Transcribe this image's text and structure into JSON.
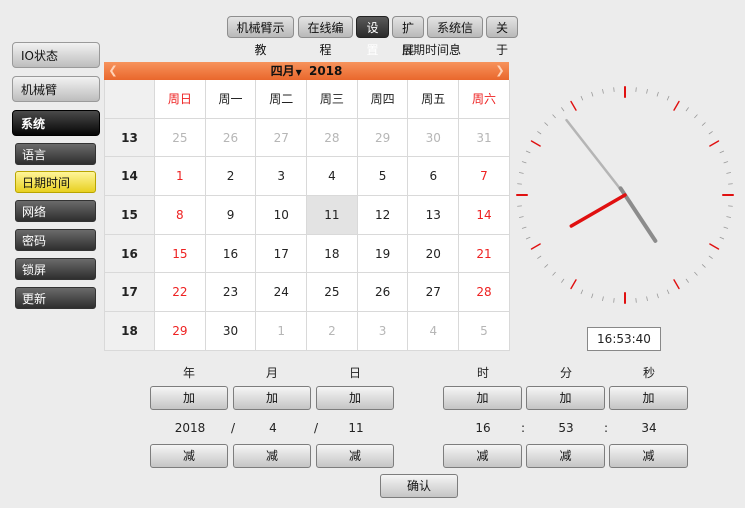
{
  "nav": {
    "tabs": [
      {
        "label": "机械臂示教",
        "active": false
      },
      {
        "label": "在线编程",
        "active": false
      },
      {
        "label": "设置",
        "active": true
      },
      {
        "label": "扩展",
        "active": false
      },
      {
        "label": "系统信息",
        "active": false
      },
      {
        "label": "关于",
        "active": false
      }
    ]
  },
  "section_title": "日期时间",
  "sidebar": {
    "main": [
      {
        "label": "IO状态"
      },
      {
        "label": "机械臂"
      },
      {
        "label": "系统",
        "active": true
      }
    ],
    "sub": [
      {
        "label": "语言"
      },
      {
        "label": "日期时间",
        "active": true
      },
      {
        "label": "网络"
      },
      {
        "label": "密码"
      },
      {
        "label": "锁屏"
      },
      {
        "label": "更新"
      }
    ]
  },
  "calendar": {
    "month": "四月",
    "year": "2018",
    "weekdays": [
      "周日",
      "周一",
      "周二",
      "周三",
      "周四",
      "周五",
      "周六"
    ],
    "weeks": [
      {
        "num": "13",
        "days": [
          "25",
          "26",
          "27",
          "28",
          "29",
          "30",
          "31"
        ]
      },
      {
        "num": "14",
        "days": [
          "1",
          "2",
          "3",
          "4",
          "5",
          "6",
          "7"
        ]
      },
      {
        "num": "15",
        "days": [
          "8",
          "9",
          "10",
          "11",
          "12",
          "13",
          "14"
        ]
      },
      {
        "num": "16",
        "days": [
          "15",
          "16",
          "17",
          "18",
          "19",
          "20",
          "21"
        ]
      },
      {
        "num": "17",
        "days": [
          "22",
          "23",
          "24",
          "25",
          "26",
          "27",
          "28"
        ]
      },
      {
        "num": "18",
        "days": [
          "29",
          "30",
          "1",
          "2",
          "3",
          "4",
          "5"
        ]
      }
    ],
    "selected_day": "11"
  },
  "clock": {
    "display": "16:53:40",
    "hour": 16,
    "minute": 53,
    "second": 40
  },
  "colors": {
    "accent": "#e9672c",
    "weekend": "#e22222",
    "hand": "#e01010"
  },
  "adjust": {
    "date_labels": [
      "年",
      "月",
      "日"
    ],
    "time_labels": [
      "时",
      "分",
      "秒"
    ],
    "inc_label": "加",
    "dec_label": "减",
    "date_values": [
      "2018",
      "4",
      "11"
    ],
    "time_values": [
      "16",
      "53",
      "34"
    ],
    "date_sep": "/",
    "time_sep": ":",
    "confirm_label": "确认"
  }
}
